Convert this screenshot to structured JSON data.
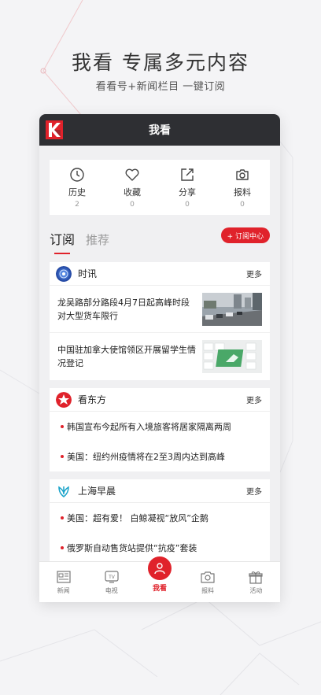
{
  "promo": {
    "headline": "我看 专属多元内容",
    "subline": "看看号+新闻栏目 一键订阅"
  },
  "app": {
    "logo_letter": "K",
    "title": "我看"
  },
  "stats": [
    {
      "icon": "history-clock-icon",
      "label": "历史",
      "count": "2"
    },
    {
      "icon": "heart-icon",
      "label": "收藏",
      "count": "0"
    },
    {
      "icon": "share-icon",
      "label": "分享",
      "count": "0"
    },
    {
      "icon": "camera-icon",
      "label": "报料",
      "count": "0"
    }
  ],
  "tabs": {
    "subscribe": "订阅",
    "recommend": "推荐",
    "subscription_center": "+ 订阅中心"
  },
  "cards": [
    {
      "name": "时讯",
      "more": "更多",
      "items": [
        {
          "text": "龙吴路部分路段4月7日起高峰时段对大型货车限行"
        },
        {
          "text": "中国驻加拿大使馆领区开展留学生情况登记"
        }
      ]
    },
    {
      "name": "看东方",
      "more": "更多",
      "items": [
        {
          "text": "韩国宣布今起所有入境旅客将居家隔离两周"
        },
        {
          "text": "美国：纽约州疫情将在2至3周内达到高峰"
        }
      ]
    },
    {
      "name": "上海早晨",
      "more": "更多",
      "items": [
        {
          "text": "美国：超有爱！ 白鲸凝视“放风”企鹅"
        },
        {
          "text": "俄罗斯自动售货站提供“抗疫”套装"
        }
      ]
    }
  ],
  "bottom_nav": [
    {
      "icon": "news-icon",
      "label": "新闻"
    },
    {
      "icon": "tv-icon",
      "label": "电视"
    },
    {
      "icon": "user-icon",
      "label": "我看"
    },
    {
      "icon": "camera-icon",
      "label": "报料"
    },
    {
      "icon": "gift-icon",
      "label": "活动"
    }
  ],
  "colors": {
    "accent": "#e0222b",
    "titlebar": "#2e2f33"
  }
}
